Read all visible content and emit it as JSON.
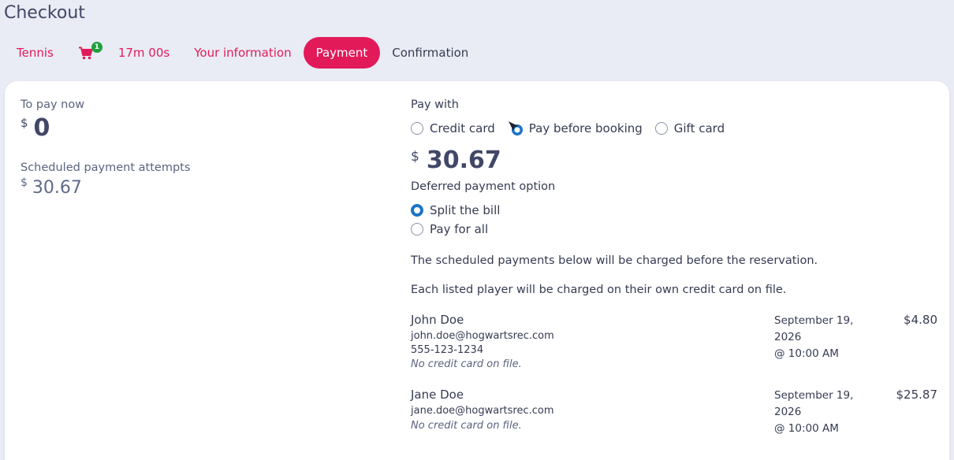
{
  "page": {
    "title": "Checkout"
  },
  "steps": {
    "sport": "Tennis",
    "cart_count": "1",
    "timer": "17m 00s",
    "info": "Your information",
    "payment": "Payment",
    "confirmation": "Confirmation"
  },
  "summary": {
    "to_pay_label": "To pay now",
    "currency": "$",
    "to_pay_value": "0",
    "scheduled_label": "Scheduled payment attempts",
    "scheduled_value": "30.67"
  },
  "pay_with": {
    "label": "Pay with",
    "options": [
      "Credit card",
      "Pay before booking",
      "Gift card"
    ],
    "selected": "Pay before booking",
    "currency": "$",
    "amount": "30.67"
  },
  "deferred": {
    "label": "Deferred payment option",
    "options": [
      "Split the bill",
      "Pay for all"
    ],
    "selected": "Split the bill"
  },
  "notes": {
    "line1": "The scheduled payments below will be charged before the reservation.",
    "line2": "Each listed player will be charged on their own credit card on file."
  },
  "players": [
    {
      "name": "John Doe",
      "email": "john.doe@hogwartsrec.com",
      "phone": "555-123-1234",
      "note": "No credit card on file.",
      "date_line1": "September 19,",
      "date_line2": "2026",
      "time": "@ 10:00 AM",
      "amount": "$4.80"
    },
    {
      "name": "Jane Doe",
      "email": "jane.doe@hogwartsrec.com",
      "note": "No credit card on file.",
      "date_line1": "September 19,",
      "date_line2": "2026",
      "time": "@ 10:00 AM",
      "amount": "$25.87"
    }
  ],
  "colors": {
    "accent": "#e21a5a",
    "radio_selected": "#1b74c9",
    "badge": "#22a03c",
    "background": "#e9ecf4"
  },
  "icons": [
    "shopping-cart-icon",
    "pay-before-booking-icon"
  ]
}
